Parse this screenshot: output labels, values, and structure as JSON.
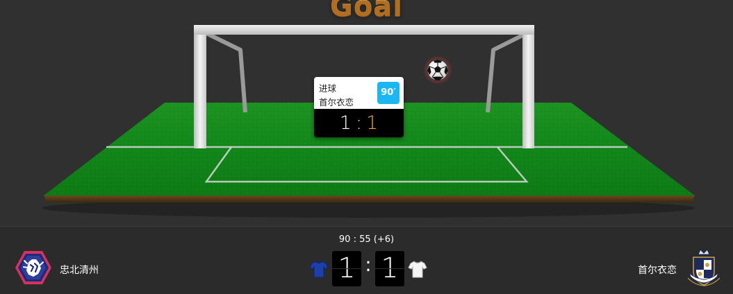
{
  "stage": {
    "title": "Goal"
  },
  "event": {
    "type": "进球",
    "team": "首尔衣恋",
    "minute": "90′",
    "score_home": "1",
    "score_separator": ":",
    "score_away": "1"
  },
  "match": {
    "clock": "90 : 55  (+6)",
    "home_team": "忠北清州",
    "away_team": "首尔衣恋",
    "home_score": "1",
    "away_score": "1",
    "separator": ":"
  },
  "icons": {
    "ball": "soccer-ball-icon",
    "home_shirt": "blue-shirt-icon",
    "away_shirt": "white-shirt-icon",
    "home_logo": "lion-crest-logo",
    "away_logo": "crown-crest-logo"
  },
  "colors": {
    "pitch": "#1a8a1e",
    "background": "#303030",
    "accent_orange": "#f0a43c",
    "minute_badge": "#1bb7f2",
    "home_kit": "#1d3fa8",
    "away_kit": "#ffffff"
  }
}
